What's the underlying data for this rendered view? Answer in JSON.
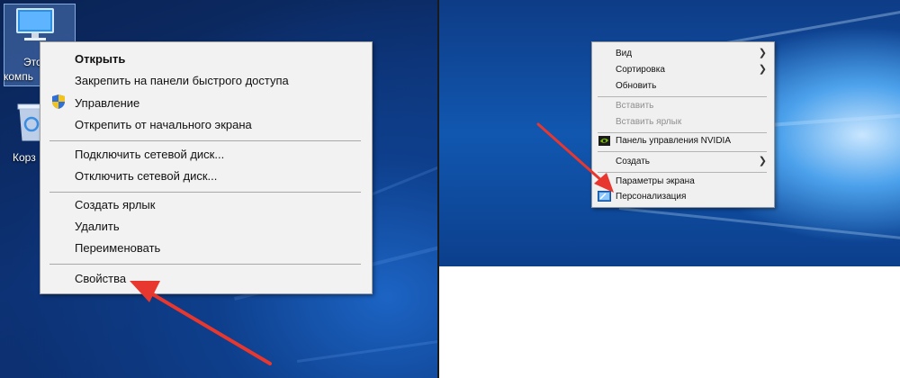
{
  "left": {
    "desktop_icons": [
      {
        "name": "this-pc",
        "label_lines": [
          "Это",
          "компь"
        ]
      },
      {
        "name": "recycle-bin",
        "label_lines": [
          "Корз"
        ]
      }
    ],
    "menu_items": [
      {
        "label": "Открыть",
        "bold": true
      },
      {
        "label": "Закрепить на панели быстрого доступа"
      },
      {
        "label": "Управление",
        "icon": "shield-icon"
      },
      {
        "label": "Открепить от начального экрана"
      },
      {
        "label": "Подключить сетевой диск..."
      },
      {
        "label": "Отключить сетевой диск..."
      },
      {
        "label": "Создать ярлык"
      },
      {
        "label": "Удалить"
      },
      {
        "label": "Переименовать"
      },
      {
        "label": "Свойства"
      }
    ]
  },
  "right": {
    "menu_items": [
      {
        "label": "Вид",
        "submenu": true
      },
      {
        "label": "Сортировка",
        "submenu": true
      },
      {
        "label": "Обновить"
      },
      {
        "label": "Вставить",
        "disabled": true
      },
      {
        "label": "Вставить ярлык",
        "disabled": true
      },
      {
        "label": "Панель управления NVIDIA",
        "icon": "nvidia-icon"
      },
      {
        "label": "Создать",
        "submenu": true
      },
      {
        "label": "Параметры экрана"
      },
      {
        "label": "Персонализация",
        "icon": "personalization-icon"
      }
    ]
  },
  "colors": {
    "arrow": "#e8372f",
    "menu_bg": "#f2f2f2"
  }
}
